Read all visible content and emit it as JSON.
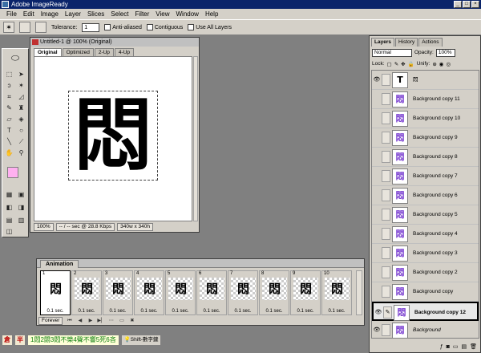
{
  "app": {
    "title": "Adobe ImageReady"
  },
  "menubar": [
    "File",
    "Edit",
    "Image",
    "Layer",
    "Slices",
    "Select",
    "Filter",
    "View",
    "Window",
    "Help"
  ],
  "options": {
    "tolerance_label": "Tolerance:",
    "tolerance_value": "1",
    "anti_aliased": "Anti-aliased",
    "contiguous": "Contiguous",
    "use_all_layers": "Use All Layers"
  },
  "document": {
    "title": "Untitled-1 @ 100% (Original)",
    "tabs": [
      "Original",
      "Optimized",
      "2-Up",
      "4-Up"
    ],
    "canvas_char": "悶",
    "status": {
      "zoom": "100%",
      "speed": "-- / -- sec @ 28.8 Kbps",
      "size": "340w x 340h"
    }
  },
  "animation": {
    "tab": "Animation",
    "frames": [
      {
        "n": "1",
        "delay": "0.1 sec."
      },
      {
        "n": "2",
        "delay": "0.1 sec."
      },
      {
        "n": "3",
        "delay": "0.1 sec."
      },
      {
        "n": "4",
        "delay": "0.1 sec."
      },
      {
        "n": "5",
        "delay": "0.1 sec."
      },
      {
        "n": "6",
        "delay": "0.1 sec."
      },
      {
        "n": "7",
        "delay": "0.1 sec."
      },
      {
        "n": "8",
        "delay": "0.1 sec."
      },
      {
        "n": "9",
        "delay": "0.1 sec."
      },
      {
        "n": "10",
        "delay": "0.1 sec."
      }
    ],
    "frame_char": "悶",
    "loop": "Forever"
  },
  "layers": {
    "tabs": [
      "Layers",
      "History",
      "Actions"
    ],
    "blend": "Normal",
    "opacity_label": "Opacity:",
    "opacity": "100%",
    "lock_label": "Lock:",
    "unify_label": "Unify:",
    "items": [
      {
        "name": "悶",
        "thumb": "T",
        "eye": "👁",
        "type": "text"
      },
      {
        "name": "Background copy 11",
        "thumb": "悶",
        "eye": ""
      },
      {
        "name": "Background copy 10",
        "thumb": "悶",
        "eye": ""
      },
      {
        "name": "Background copy 9",
        "thumb": "悶",
        "eye": ""
      },
      {
        "name": "Background copy 8",
        "thumb": "悶",
        "eye": ""
      },
      {
        "name": "Background copy 7",
        "thumb": "悶",
        "eye": ""
      },
      {
        "name": "Background copy 6",
        "thumb": "悶",
        "eye": ""
      },
      {
        "name": "Background copy 5",
        "thumb": "悶",
        "eye": ""
      },
      {
        "name": "Background copy 4",
        "thumb": "悶",
        "eye": ""
      },
      {
        "name": "Background copy 3",
        "thumb": "悶",
        "eye": ""
      },
      {
        "name": "Background copy 2",
        "thumb": "悶",
        "eye": ""
      },
      {
        "name": "Background copy",
        "thumb": "悶",
        "eye": ""
      },
      {
        "name": "Background copy 12",
        "thumb": "悶",
        "eye": "👁",
        "active": true
      },
      {
        "name": "Background",
        "thumb": "悶",
        "eye": "👁"
      }
    ]
  },
  "ime": {
    "mode1": "倉",
    "mode2": "半",
    "composition": "1悶2閟3悶不樂4聲不響5死6吝",
    "hint": "Shift-數字鍵"
  }
}
